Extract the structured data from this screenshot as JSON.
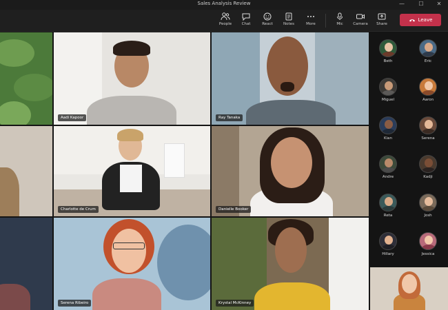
{
  "window": {
    "title": "Sales Analysis Review"
  },
  "toolbar": {
    "buttons": [
      {
        "label": "People",
        "icon": "people-icon"
      },
      {
        "label": "Chat",
        "icon": "chat-icon"
      },
      {
        "label": "React",
        "icon": "react-icon"
      },
      {
        "label": "Notes",
        "icon": "notes-icon"
      },
      {
        "label": "More",
        "icon": "more-icon"
      },
      {
        "label": "Mic",
        "icon": "mic-icon"
      },
      {
        "label": "Camera",
        "icon": "camera-icon"
      },
      {
        "label": "Share",
        "icon": "share-icon"
      }
    ],
    "leave_label": "Leave",
    "leave_color": "#c4314b"
  },
  "grid": {
    "tiles": [
      {
        "name": ""
      },
      {
        "name": "Aadi Kapoor"
      },
      {
        "name": "Ray Tanaka"
      },
      {
        "name": ""
      },
      {
        "name": "Charlotte de Crum"
      },
      {
        "name": "Danielle Booker"
      },
      {
        "name": ""
      },
      {
        "name": "Serena Ribeiro"
      },
      {
        "name": "Krystal McKinney"
      },
      {
        "name": ""
      }
    ]
  },
  "roster": {
    "people": [
      "Beth",
      "Eric",
      "Miguel",
      "Aaron",
      "Kian",
      "Serena",
      "Andre",
      "Kadji",
      "Reta",
      "Josh",
      "Hillary",
      "Jessica"
    ]
  }
}
